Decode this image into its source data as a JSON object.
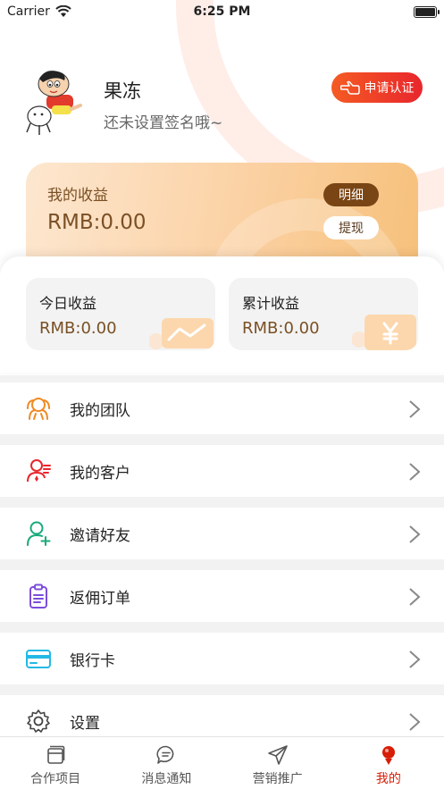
{
  "status_bar": {
    "carrier": "Carrier",
    "time": "6:25 PM"
  },
  "profile": {
    "name": "果冻",
    "signature": "还未设置签名哦~",
    "apply_button": "申请认证"
  },
  "earnings": {
    "title": "我的收益",
    "amount": "RMB:0.00",
    "detail_button": "明细",
    "withdraw_button": "提现"
  },
  "stats": [
    {
      "label": "今日收益",
      "value": "RMB:0.00"
    },
    {
      "label": "累计收益",
      "value": "RMB:0.00"
    }
  ],
  "menu": [
    {
      "label": "我的团队",
      "icon": "team-icon"
    },
    {
      "label": "我的客户",
      "icon": "customer-icon"
    },
    {
      "label": "邀请好友",
      "icon": "add-user-icon"
    },
    {
      "label": "返佣订单",
      "icon": "clipboard-icon"
    },
    {
      "label": "银行卡",
      "icon": "bank-card-icon"
    },
    {
      "label": "设置",
      "icon": "gear-icon"
    }
  ],
  "tabs": [
    {
      "label": "合作项目",
      "icon": "projects-icon"
    },
    {
      "label": "消息通知",
      "icon": "message-icon"
    },
    {
      "label": "营销推广",
      "icon": "paper-plane-icon"
    },
    {
      "label": "我的",
      "icon": "profile-icon"
    }
  ],
  "active_tab": "我的",
  "colors": {
    "accent_red": "#d81e06",
    "earnings_brown": "#7a5025",
    "team_orange": "#f08a24",
    "customer_red": "#e8262d",
    "invite_green": "#1aa97b",
    "order_purple": "#7c4ddb",
    "card_cyan": "#23b9e6"
  }
}
